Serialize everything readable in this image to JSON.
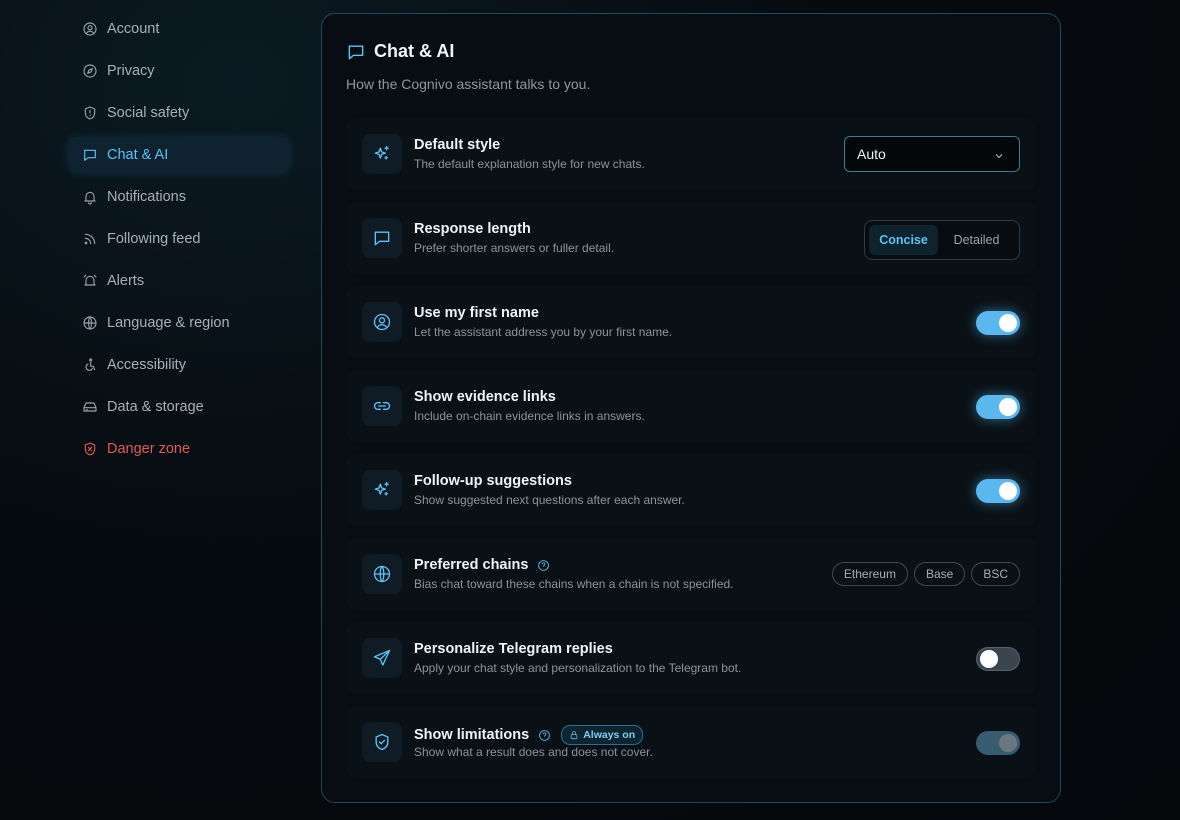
{
  "sidebar": {
    "items": [
      {
        "label": "Account",
        "icon": "user-circle-icon"
      },
      {
        "label": "Privacy",
        "icon": "compass-icon"
      },
      {
        "label": "Social safety",
        "icon": "shield-icon"
      },
      {
        "label": "Chat & AI",
        "icon": "chat-icon",
        "active": true
      },
      {
        "label": "Notifications",
        "icon": "bell-icon"
      },
      {
        "label": "Following feed",
        "icon": "rss-icon"
      },
      {
        "label": "Alerts",
        "icon": "alarm-icon"
      },
      {
        "label": "Language & region",
        "icon": "globe-icon"
      },
      {
        "label": "Accessibility",
        "icon": "accessibility-icon"
      },
      {
        "label": "Data & storage",
        "icon": "drive-icon"
      },
      {
        "label": "Danger zone",
        "icon": "danger-shield-icon",
        "danger": true
      }
    ]
  },
  "panel": {
    "title": "Chat & AI",
    "subtitle": "How the Cognivo assistant talks to you.",
    "rows": {
      "default_style": {
        "title": "Default style",
        "desc": "The default explanation style for new chats.",
        "value": "Auto"
      },
      "response_length": {
        "title": "Response length",
        "desc": "Prefer shorter answers or fuller detail.",
        "options": [
          "Concise",
          "Detailed"
        ],
        "selected": "Concise"
      },
      "first_name": {
        "title": "Use my first name",
        "desc": "Let the assistant address you by your first name.",
        "enabled": true
      },
      "evidence_links": {
        "title": "Show evidence links",
        "desc": "Include on-chain evidence links in answers.",
        "enabled": true
      },
      "follow_up": {
        "title": "Follow-up suggestions",
        "desc": "Show suggested next questions after each answer.",
        "enabled": true
      },
      "preferred_chains": {
        "title": "Preferred chains",
        "desc": "Bias chat toward these chains when a chain is not specified.",
        "chains": [
          "Ethereum",
          "Base",
          "BSC"
        ]
      },
      "telegram": {
        "title": "Personalize Telegram replies",
        "desc": "Apply your chat style and personalization to the Telegram bot.",
        "enabled": false
      },
      "limitations": {
        "title": "Show limitations",
        "badge": "Always on",
        "desc": "Show what a result does and does not cover.",
        "enabled": true,
        "locked": true
      }
    }
  },
  "colors": {
    "accent": "#5cc4f2",
    "danger": "#e05a5a",
    "border": "#1e4c5e"
  }
}
